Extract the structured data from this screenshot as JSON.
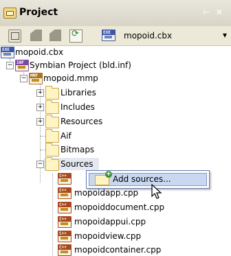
{
  "panel": {
    "title": "Project",
    "title_controls": "⊢ ✕",
    "toolbar": {
      "file_badge": "EXE",
      "file_label": "mopoid.cbx",
      "more": "▾"
    }
  },
  "tree": {
    "root": {
      "label": "mopoid.cbx",
      "badge": "EXE",
      "badge_color": "#3b56a8"
    },
    "project": {
      "label": "Symbian Project (bld.inf)",
      "badge": "INF",
      "badge_color": "#7d4aa0",
      "expander": "−"
    },
    "mmp": {
      "label": "mopoid.mmp",
      "badge": "MMP",
      "badge_color": "#b0721e",
      "expander": "−"
    },
    "folders": [
      {
        "label": "Libraries",
        "expander": "+"
      },
      {
        "label": "Includes",
        "expander": "+"
      },
      {
        "label": "Resources",
        "expander": "+"
      },
      {
        "label": "Aif",
        "expander": ""
      },
      {
        "label": "Bitmaps",
        "expander": ""
      },
      {
        "label": "Sources",
        "expander": "−"
      }
    ],
    "sources": [
      {
        "label": "",
        "badge": "C++"
      },
      {
        "label": "mopoidapp.cpp",
        "badge": "C++"
      },
      {
        "label": "mopoiddocument.cpp",
        "badge": "C++"
      },
      {
        "label": "mopoidappui.cpp",
        "badge": "C++"
      },
      {
        "label": "mopoidview.cpp",
        "badge": "C++"
      },
      {
        "label": "mopoidcontainer.cpp",
        "badge": "C++"
      }
    ],
    "cpp_badge_color": "#a9471d"
  },
  "context_menu": {
    "items": [
      {
        "label": "Add sources..."
      }
    ]
  }
}
